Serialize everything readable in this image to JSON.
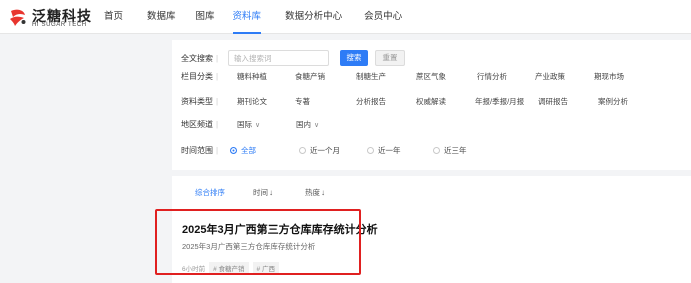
{
  "brand": {
    "name_cn": "泛糖科技",
    "name_en": "HI SUGAR TECH",
    "accent": "#2e7cf6",
    "logo_red": "#e8352e"
  },
  "nav": [
    {
      "label": "首页"
    },
    {
      "label": "数据库"
    },
    {
      "label": "图库"
    },
    {
      "label": "资料库",
      "active": true
    },
    {
      "label": "数据分析中心"
    },
    {
      "label": "会员中心"
    }
  ],
  "filters": {
    "search": {
      "label": "全文搜索",
      "placeholder": "输入搜索词",
      "value": "",
      "search_button": "搜索",
      "reset_button": "重置"
    },
    "column": {
      "label": "栏目分类",
      "items": [
        "糖料种植",
        "食糖产销",
        "制糖生产",
        "蔗区气象",
        "行情分析",
        "产业政策",
        "期现市场"
      ]
    },
    "type": {
      "label": "资料类型",
      "items": [
        "期刊论文",
        "专著",
        "分析报告",
        "权威解读",
        "年报/季报/月报",
        "调研报告",
        "案例分析"
      ]
    },
    "region": {
      "label": "地区频道",
      "items": [
        "国际",
        "国内"
      ]
    },
    "time": {
      "label": "时间范围",
      "items": [
        "全部",
        "近一个月",
        "近一年",
        "近三年"
      ],
      "selected": "全部"
    }
  },
  "sort": {
    "items": [
      {
        "label": "综合排序",
        "active": true
      },
      {
        "label": "时间"
      },
      {
        "label": "热度"
      }
    ],
    "arrow": "↓"
  },
  "result": {
    "title": "2025年3月广西第三方仓库库存统计分析",
    "subtitle": "2025年3月广西第三方仓库库存统计分析",
    "time": "6小时前",
    "tags": [
      "# 食糖产销",
      "# 广西"
    ]
  },
  "annotation_color": "#e02020"
}
